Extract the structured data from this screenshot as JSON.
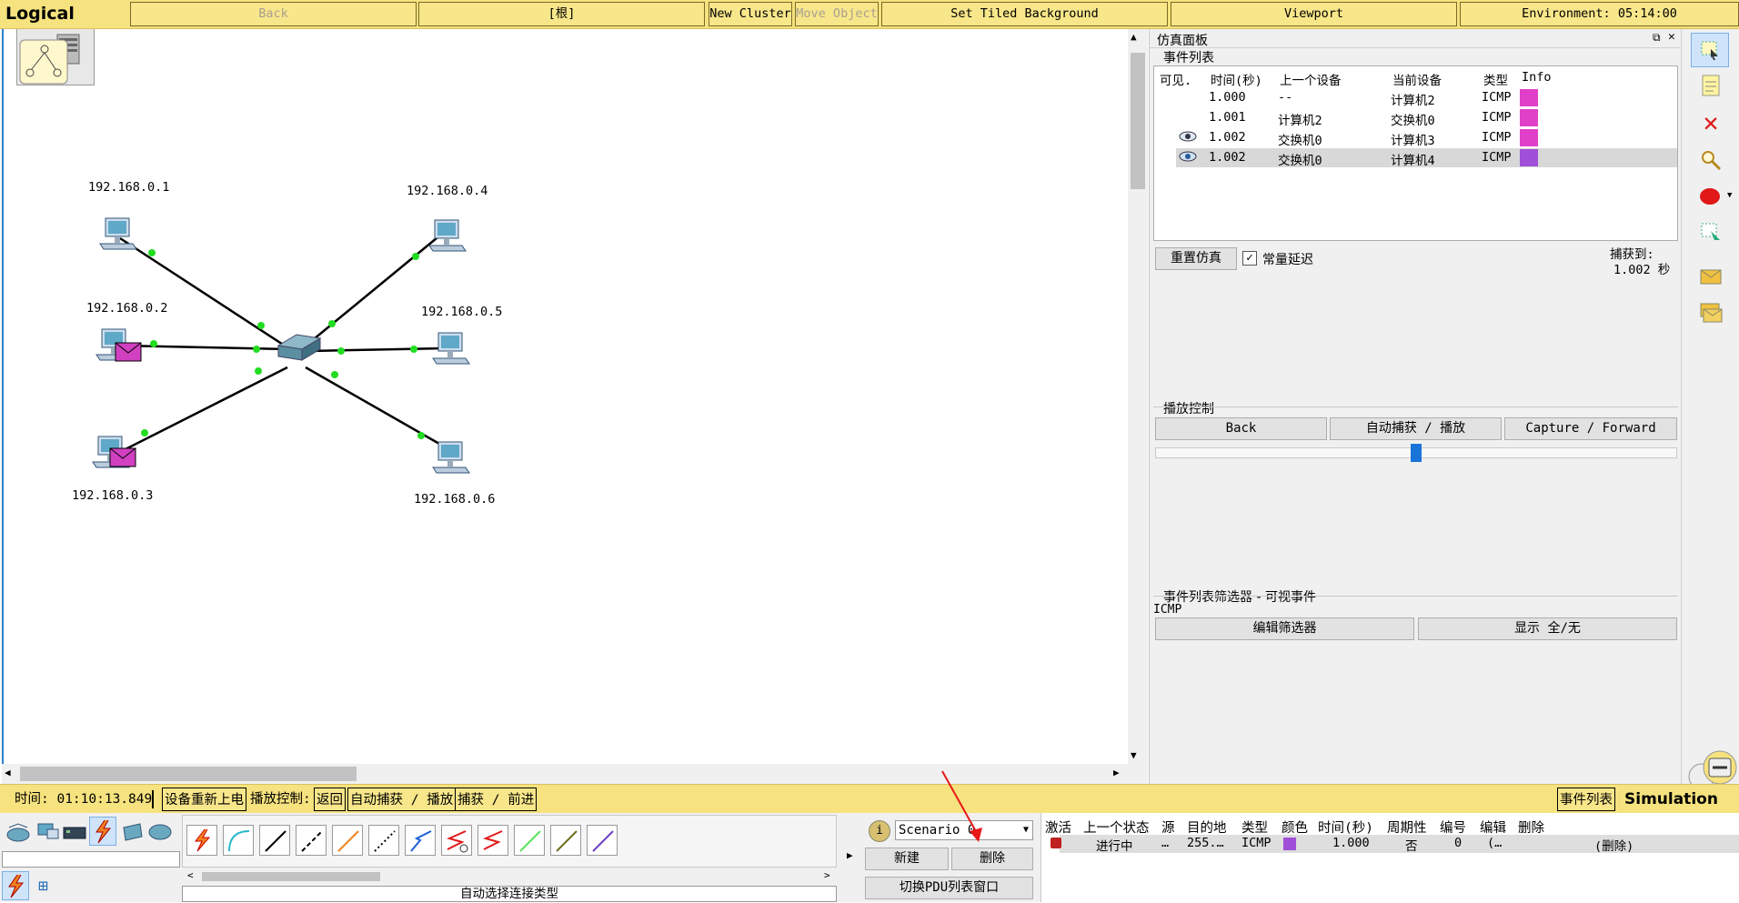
{
  "topbar": {
    "logical": "Logical",
    "back": "Back",
    "root": "[根]",
    "new_cluster": "New Cluster",
    "move_object": "Move Object",
    "set_tiled_background": "Set Tiled Background",
    "viewport": "Viewport",
    "environment": "Environment: 05:14:00"
  },
  "topology": {
    "ips": [
      "192.168.0.1",
      "192.168.0.2",
      "192.168.0.3",
      "192.168.0.4",
      "192.168.0.5",
      "192.168.0.6"
    ]
  },
  "sim_panel": {
    "title": "仿真面板",
    "event_list_title": "事件列表",
    "columns": [
      "可见.",
      "时间(秒)",
      "上一个设备",
      "当前设备",
      "类型",
      "Info"
    ],
    "events": [
      {
        "visible": "",
        "time": "1.000",
        "prev": "--",
        "current": "计算机2",
        "type": "ICMP",
        "color": "#e040c8"
      },
      {
        "visible": "",
        "time": "1.001",
        "prev": "计算机2",
        "current": "交换机0",
        "type": "ICMP",
        "color": "#e040c8"
      },
      {
        "visible": "eye-icon",
        "time": "1.002",
        "prev": "交换机0",
        "current": "计算机3",
        "type": "ICMP",
        "color": "#e040c8"
      },
      {
        "visible": "eye-icon",
        "time": "1.002",
        "prev": "交换机0",
        "current": "计算机4",
        "type": "ICMP",
        "color": "#a050d8"
      }
    ],
    "reset_simulation": "重置仿真",
    "constant_delay": "常量延迟",
    "constant_delay_checked": true,
    "captured_to_label": "捕获到:",
    "captured_to_value": "1.002 秒",
    "playback_title": "播放控制",
    "playback_back": "Back",
    "playback_auto": "自动捕获 / 播放",
    "playback_capture_forward": "Capture / Forward",
    "playback_speed_fraction": 0.5,
    "filter_title": "事件列表筛选器 - 可视事件",
    "filter_value": "ICMP",
    "edit_filter": "编辑筛选器",
    "show_all_none": "显示 全/无"
  },
  "statusbar": {
    "time": "时间: 01:10:13.849",
    "power_cycle": "设备重新上电",
    "playback_label": "播放控制:",
    "back": "返回",
    "auto_capture": "自动捕获 / 播放",
    "capture_forward": "捕获 / 前进",
    "event_list": "事件列表",
    "mode": "Simulation"
  },
  "bottom": {
    "scenario": "Scenario 0",
    "new": "新建",
    "delete": "删除",
    "toggle_pdu": "切换PDU列表窗口",
    "connection_hint": "自动选择连接类型",
    "pdu_columns": [
      "激活",
      "上一个状态",
      "源",
      "目的地",
      "类型",
      "颜色",
      "时间(秒)",
      "周期性",
      "编号",
      "编辑",
      "删除"
    ],
    "pdu_rows": [
      {
        "state": "进行中",
        "source": "…",
        "dest": "255.…",
        "type": "ICMP",
        "color": "#a050d8",
        "time": "1.000",
        "periodic": "否",
        "num": "0",
        "edit": "(…",
        "delete": "(删除)"
      }
    ]
  },
  "colors": {
    "yellow_bar": "#f6e27e",
    "link_light": "#22dd22",
    "envelope": "#d040c0"
  }
}
